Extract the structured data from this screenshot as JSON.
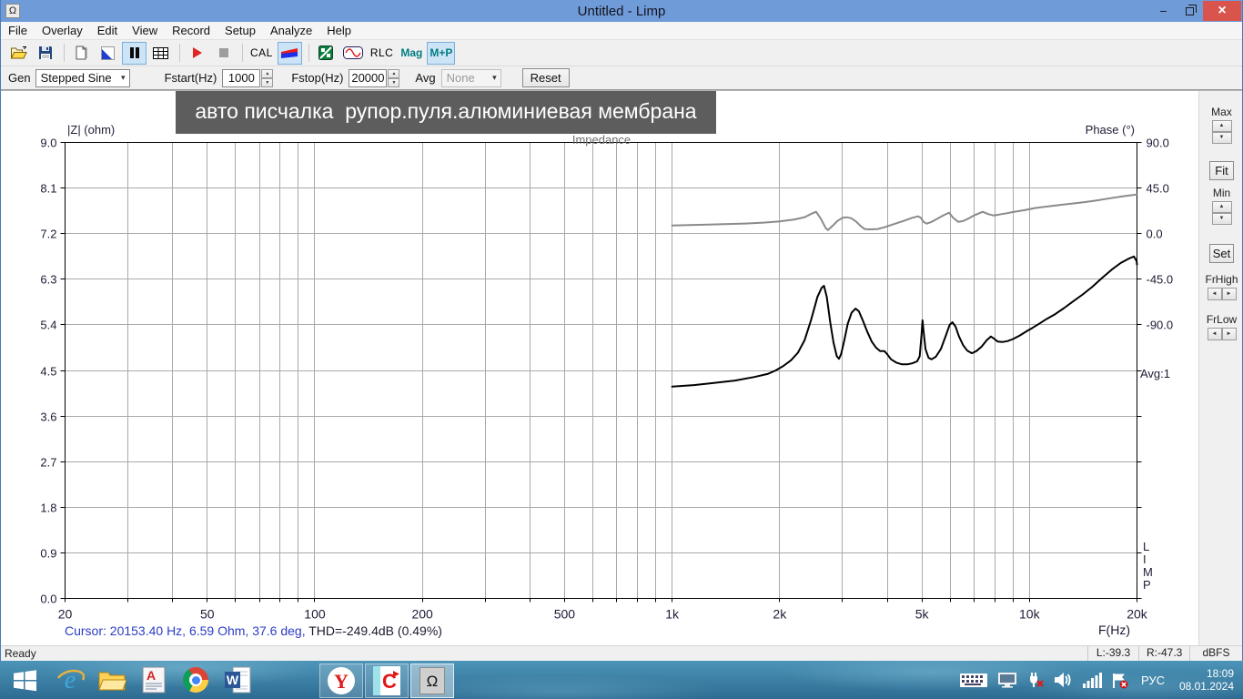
{
  "window": {
    "title": "Untitled - Limp",
    "icon_glyph": "Ω",
    "minimize_glyph": "−",
    "close_glyph": "×"
  },
  "menu": {
    "items": [
      "File",
      "Overlay",
      "Edit",
      "View",
      "Record",
      "Setup",
      "Analyze",
      "Help"
    ]
  },
  "toolbar": {
    "buttons": [
      {
        "name": "open",
        "type": "icon"
      },
      {
        "name": "save",
        "type": "icon"
      },
      {
        "name": "sep"
      },
      {
        "name": "copy",
        "type": "icon"
      },
      {
        "name": "pen",
        "type": "icon"
      },
      {
        "name": "pause",
        "type": "icon",
        "active": true
      },
      {
        "name": "table",
        "type": "icon"
      },
      {
        "name": "sep"
      },
      {
        "name": "play",
        "type": "icon"
      },
      {
        "name": "stop",
        "type": "icon"
      },
      {
        "name": "sep"
      },
      {
        "name": "cal",
        "type": "text",
        "label": "CAL"
      },
      {
        "name": "imp",
        "type": "icon",
        "active": true
      },
      {
        "name": "sep"
      },
      {
        "name": "spectrum",
        "type": "icon"
      },
      {
        "name": "sine",
        "type": "icon"
      },
      {
        "name": "rlc",
        "type": "text",
        "label": "RLC"
      },
      {
        "name": "mag",
        "type": "text",
        "label": "Mag",
        "teal": true
      },
      {
        "name": "mp",
        "type": "text",
        "label": "M+P",
        "teal": true,
        "active": true
      }
    ]
  },
  "genbar": {
    "gen_label": "Gen",
    "gen_value": "Stepped Sine",
    "fstart_label": "Fstart(Hz)",
    "fstart_value": "1000",
    "fstop_label": "Fstop(Hz)",
    "fstop_value": "20000",
    "avg_label": "Avg",
    "avg_value": "None",
    "reset_label": "Reset"
  },
  "overlay_note": "авто писчалка  рупор.пуля.алюминиевая мембрана",
  "chart_data": {
    "type": "line",
    "title": "Impedance",
    "colors": {
      "grid": "#a9a9a9",
      "axis_text": "#201a35",
      "impedance": "#000000",
      "phase": "#8a8a8a"
    },
    "y_left": {
      "label": "|Z| (ohm)",
      "min": 0,
      "max": 9,
      "ticks": [
        "9.0",
        "8.1",
        "7.2",
        "6.3",
        "5.4",
        "4.5",
        "3.6",
        "2.7",
        "1.8",
        "0.9",
        "0.0"
      ]
    },
    "y_right": {
      "label": "Phase (°)",
      "deg_per_div": 45,
      "ticks": [
        "90.0",
        "45.0",
        "0.0",
        "-45.0",
        "-90.0"
      ]
    },
    "x": {
      "label": "F(Hz)",
      "min": 20,
      "max": 20000,
      "scale": "log",
      "gridlines": [
        20,
        30,
        40,
        50,
        60,
        70,
        80,
        90,
        100,
        200,
        300,
        400,
        500,
        600,
        700,
        800,
        900,
        1000,
        2000,
        3000,
        4000,
        5000,
        6000,
        7000,
        8000,
        9000,
        10000,
        20000
      ],
      "major_values": [
        20,
        50,
        100,
        200,
        500,
        1000,
        2000,
        5000,
        10000,
        20000
      ],
      "major_ticks": [
        "20",
        "50",
        "100",
        "200",
        "500",
        "1k",
        "2k",
        "5k",
        "10k",
        "20k"
      ]
    },
    "series": [
      {
        "name": "impedance",
        "axis": "left",
        "color": "#000000",
        "points": [
          [
            1000,
            4.18
          ],
          [
            1150,
            4.21
          ],
          [
            1300,
            4.25
          ],
          [
            1500,
            4.3
          ],
          [
            1700,
            4.37
          ],
          [
            1850,
            4.43
          ],
          [
            1950,
            4.5
          ],
          [
            2050,
            4.59
          ],
          [
            2150,
            4.7
          ],
          [
            2250,
            4.85
          ],
          [
            2350,
            5.1
          ],
          [
            2450,
            5.5
          ],
          [
            2550,
            5.95
          ],
          [
            2620,
            6.13
          ],
          [
            2660,
            6.17
          ],
          [
            2710,
            5.95
          ],
          [
            2770,
            5.45
          ],
          [
            2830,
            5.05
          ],
          [
            2890,
            4.78
          ],
          [
            2930,
            4.73
          ],
          [
            2970,
            4.82
          ],
          [
            3030,
            5.08
          ],
          [
            3100,
            5.42
          ],
          [
            3180,
            5.64
          ],
          [
            3260,
            5.72
          ],
          [
            3330,
            5.67
          ],
          [
            3420,
            5.48
          ],
          [
            3520,
            5.26
          ],
          [
            3620,
            5.07
          ],
          [
            3720,
            4.95
          ],
          [
            3820,
            4.88
          ],
          [
            3930,
            4.88
          ],
          [
            4000,
            4.82
          ],
          [
            4100,
            4.72
          ],
          [
            4250,
            4.65
          ],
          [
            4400,
            4.62
          ],
          [
            4550,
            4.62
          ],
          [
            4700,
            4.64
          ],
          [
            4850,
            4.68
          ],
          [
            4930,
            4.78
          ],
          [
            4990,
            5.2
          ],
          [
            5020,
            5.49
          ],
          [
            5060,
            5.25
          ],
          [
            5120,
            4.92
          ],
          [
            5220,
            4.75
          ],
          [
            5320,
            4.72
          ],
          [
            5470,
            4.77
          ],
          [
            5650,
            4.92
          ],
          [
            5830,
            5.18
          ],
          [
            5980,
            5.4
          ],
          [
            6090,
            5.45
          ],
          [
            6210,
            5.37
          ],
          [
            6350,
            5.17
          ],
          [
            6520,
            5.0
          ],
          [
            6700,
            4.89
          ],
          [
            6900,
            4.84
          ],
          [
            7100,
            4.88
          ],
          [
            7350,
            4.97
          ],
          [
            7600,
            5.1
          ],
          [
            7800,
            5.17
          ],
          [
            7950,
            5.13
          ],
          [
            8150,
            5.07
          ],
          [
            8400,
            5.06
          ],
          [
            8700,
            5.08
          ],
          [
            9000,
            5.12
          ],
          [
            9400,
            5.19
          ],
          [
            9800,
            5.27
          ],
          [
            10200,
            5.34
          ],
          [
            10700,
            5.43
          ],
          [
            11200,
            5.52
          ],
          [
            11800,
            5.61
          ],
          [
            12500,
            5.73
          ],
          [
            13300,
            5.87
          ],
          [
            14100,
            6.0
          ],
          [
            15000,
            6.15
          ],
          [
            16000,
            6.33
          ],
          [
            17000,
            6.49
          ],
          [
            18000,
            6.62
          ],
          [
            19000,
            6.71
          ],
          [
            19600,
            6.75
          ],
          [
            19950,
            6.66
          ],
          [
            20153,
            6.59
          ]
        ]
      },
      {
        "name": "phase",
        "axis": "right",
        "color": "#8a8a8a",
        "points": [
          [
            1000,
            8.1
          ],
          [
            1200,
            8.7
          ],
          [
            1400,
            9.3
          ],
          [
            1600,
            10.0
          ],
          [
            1800,
            10.9
          ],
          [
            2000,
            12.0
          ],
          [
            2200,
            14.0
          ],
          [
            2350,
            16.3
          ],
          [
            2460,
            19.8
          ],
          [
            2530,
            21.6
          ],
          [
            2610,
            14.5
          ],
          [
            2690,
            5.5
          ],
          [
            2730,
            3.6
          ],
          [
            2810,
            7.5
          ],
          [
            2900,
            12.5
          ],
          [
            3000,
            15.6
          ],
          [
            3080,
            16.2
          ],
          [
            3170,
            15.3
          ],
          [
            3270,
            12.0
          ],
          [
            3370,
            7.5
          ],
          [
            3460,
            4.5
          ],
          [
            3600,
            4.2
          ],
          [
            3760,
            4.6
          ],
          [
            3920,
            6.2
          ],
          [
            4120,
            8.8
          ],
          [
            4400,
            12.0
          ],
          [
            4700,
            15.6
          ],
          [
            4880,
            17.1
          ],
          [
            4960,
            15.8
          ],
          [
            5060,
            11.5
          ],
          [
            5160,
            9.9
          ],
          [
            5320,
            11.6
          ],
          [
            5520,
            14.6
          ],
          [
            5760,
            18.2
          ],
          [
            5960,
            20.7
          ],
          [
            6120,
            15.5
          ],
          [
            6320,
            11.7
          ],
          [
            6520,
            12.4
          ],
          [
            6740,
            14.8
          ],
          [
            7020,
            18.2
          ],
          [
            7400,
            21.6
          ],
          [
            7680,
            19.2
          ],
          [
            7920,
            18.0
          ],
          [
            8240,
            18.9
          ],
          [
            8640,
            20.1
          ],
          [
            9060,
            21.6
          ],
          [
            9660,
            23.1
          ],
          [
            10350,
            25.2
          ],
          [
            11300,
            26.9
          ],
          [
            12600,
            28.9
          ],
          [
            13900,
            30.6
          ],
          [
            15200,
            32.4
          ],
          [
            16600,
            34.6
          ],
          [
            18300,
            36.9
          ],
          [
            19500,
            38.1
          ],
          [
            20153,
            38.7
          ]
        ]
      }
    ]
  },
  "side_panel": {
    "max_label": "Max",
    "fit_label": "Fit",
    "min_label": "Min",
    "set_label": "Set",
    "frhigh_label": "FrHigh",
    "frlow_label": "FrLow",
    "avg_indicator": "Avg:1",
    "limp_vertical": "L\nI\nM\nP"
  },
  "cursor": {
    "part1": "Cursor: 20153.40 Hz, 6.59 Ohm, 37.6 deg,",
    "part2": " THD=-249.4dB (0.49%)"
  },
  "statusbar": {
    "ready": "Ready",
    "left_level": "L:-39.3",
    "right_level": "R:-47.3",
    "unit": "dBFS"
  },
  "taskbar": {
    "apps": [
      "ie",
      "explorer",
      "abbyy",
      "chrome",
      "word"
    ],
    "running": [
      {
        "name": "yandex"
      },
      {
        "name": "updater"
      },
      {
        "name": "limp",
        "active": true
      }
    ],
    "tray_icons": [
      "keyboard",
      "display",
      "network-off",
      "volume",
      "signal",
      "alert-flag"
    ],
    "lang": "РУС",
    "time": "18:09",
    "date": "08.01.2024"
  }
}
